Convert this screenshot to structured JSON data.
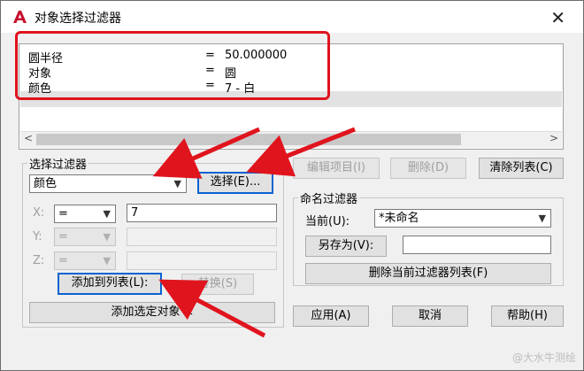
{
  "window": {
    "title": "对象选择过滤器",
    "close_label": "✕"
  },
  "filter_list": {
    "rows": [
      {
        "key": "圆半径",
        "eq": "=",
        "value": "50.000000"
      },
      {
        "key": "对象",
        "eq": "=",
        "value": "圆"
      },
      {
        "key": "颜色",
        "eq": "=",
        "value": "7 - 白"
      }
    ],
    "scroll_left": "<",
    "scroll_right": ">"
  },
  "select_filter": {
    "label": "选择过滤器",
    "type_value": "颜色",
    "select_button": "选择(E)...",
    "x_label": "X:",
    "x_op": "=",
    "x_value": "7",
    "y_label": "Y:",
    "y_op": "=",
    "z_label": "Z:",
    "z_op": "=",
    "add_to_list": "添加到列表(L):",
    "replace": "替换(S)",
    "add_selected": "添加选定对象 <"
  },
  "top_buttons": {
    "edit_item": "编辑项目(I)",
    "delete": "删除(D)",
    "clear_list": "清除列表(C)"
  },
  "named_filter": {
    "label": "命名过滤器",
    "current_label": "当前(U):",
    "current_value": "*未命名",
    "save_as": "另存为(V):",
    "save_as_value": "",
    "delete_current": "删除当前过滤器列表(F)"
  },
  "bottom_buttons": {
    "apply": "应用(A)",
    "cancel": "取消",
    "help": "帮助(H)"
  },
  "watermark": "@大水牛测绘",
  "colors": {
    "highlight_box": "#e0141d",
    "arrow": "#e0141d",
    "default_button_border": "#0a63d1"
  },
  "icons": {
    "app": "autocad-icon",
    "dropdown": "chevron-down-icon"
  }
}
